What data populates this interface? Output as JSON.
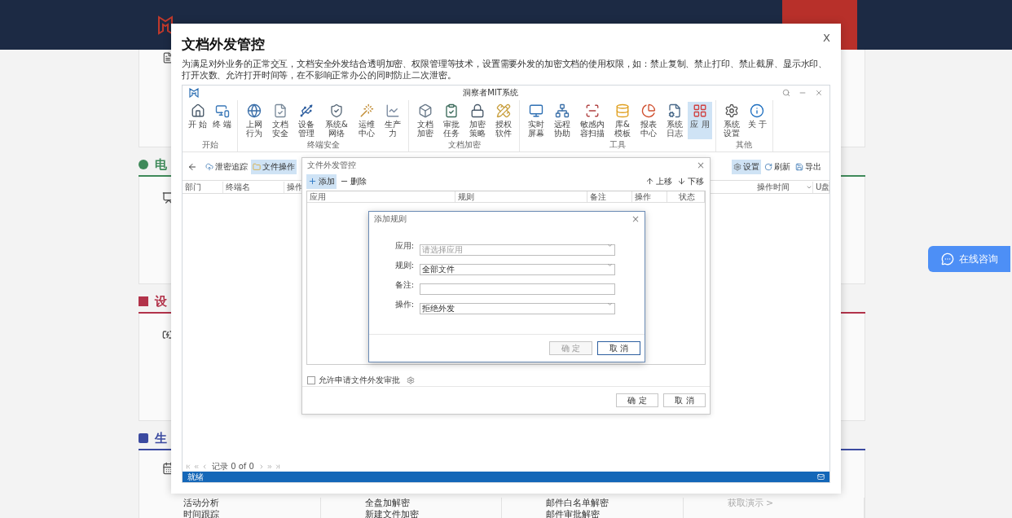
{
  "page": {
    "sections": [
      {
        "heading": "电",
        "color": "#3f8a5a"
      },
      {
        "heading": "设",
        "color": "#b2334a"
      },
      {
        "heading": "生",
        "color": "#3b4aa0"
      }
    ],
    "link_columns": [
      {
        "items": [
          "活动分析",
          "时间跟踪"
        ]
      },
      {
        "items": [
          "全盘加解密",
          "新建文件加密"
        ]
      },
      {
        "items": [
          "邮件白名单解密",
          "邮件审批解密"
        ]
      },
      {
        "items": [
          "获取演示 >"
        ],
        "muted": true
      }
    ],
    "consult_button": "在线咨询"
  },
  "modal": {
    "title": "文档外发管控",
    "close": "X",
    "description": "为满足对外业务的正常交互，文档安全外发结合透明加密、权限管理等技术，设置需要外发的加密文档的使用权限，如：禁止复制、禁止打印、禁止截屏、显示水印、打开次数、允许打开时间等，在不影响正常办公的同时防止二次泄密。"
  },
  "app": {
    "title": "洞察者MIT系统",
    "ribbon": [
      {
        "group": "开始",
        "items": [
          {
            "label": "开 始",
            "selected": false
          },
          {
            "label": "终 端",
            "selected": false
          }
        ]
      },
      {
        "group": "终端安全",
        "items": [
          {
            "label": "上网行为",
            "selected": false
          },
          {
            "label": "文档安全",
            "selected": false
          },
          {
            "label": "设备管理",
            "selected": false
          },
          {
            "label": "系统&网络",
            "selected": false
          },
          {
            "label": "运维中心",
            "selected": false
          },
          {
            "label": "生产力",
            "selected": false
          }
        ]
      },
      {
        "group": "文档加密",
        "items": [
          {
            "label": "文档加密",
            "selected": false
          },
          {
            "label": "审批任务",
            "selected": false
          },
          {
            "label": "加密策略",
            "selected": false
          },
          {
            "label": "授权软件",
            "selected": false
          }
        ]
      },
      {
        "group": "工具",
        "items": [
          {
            "label": "实时屏幕",
            "selected": false
          },
          {
            "label": "远程协助",
            "selected": false
          },
          {
            "label": "敏感内容扫描",
            "selected": false
          },
          {
            "label": "库&模板",
            "selected": false
          },
          {
            "label": "报表中心",
            "selected": false
          },
          {
            "label": "系统日志",
            "selected": false
          },
          {
            "label": "应 用",
            "selected": true
          }
        ]
      },
      {
        "group": "其他",
        "items": [
          {
            "label": "系统设置",
            "selected": false
          },
          {
            "label": "关 于",
            "selected": false
          }
        ]
      }
    ],
    "toolbar_left": [
      {
        "label": "泄密追踪",
        "selected": false
      },
      {
        "label": "文件操作",
        "selected": true
      }
    ],
    "toolbar_right": [
      {
        "label": "设置",
        "selected": true
      },
      {
        "label": "刷新",
        "selected": false
      },
      {
        "label": "导出",
        "selected": false
      }
    ],
    "columns_left": [
      "部门",
      "终端名",
      "操作"
    ],
    "columns_right": [
      "操作时间",
      "U盘"
    ],
    "pager": "记录 0 of 0",
    "status": "就绪"
  },
  "dialog": {
    "title": "文件外发管控",
    "close": "×",
    "toolbar_left": [
      {
        "label": "添加",
        "selected": true
      },
      {
        "label": "删除",
        "selected": false
      }
    ],
    "toolbar_right": [
      {
        "label": "上移"
      },
      {
        "label": "下移"
      }
    ],
    "columns": [
      "应用",
      "规则",
      "备注",
      "操作",
      "状态"
    ],
    "allow": {
      "label": "允许申请文件外发审批",
      "checked": false
    },
    "buttons": [
      {
        "label": "确 定"
      },
      {
        "label": "取 消"
      }
    ]
  },
  "rule_dialog": {
    "title": "添加规则",
    "close": "×",
    "fields": [
      {
        "label": "应用:",
        "kind": "select",
        "placeholder": "请选择应用"
      },
      {
        "label": "规则:",
        "kind": "select",
        "value": "全部文件"
      },
      {
        "label": "备注:",
        "kind": "text"
      },
      {
        "label": "操作:",
        "kind": "select",
        "value": "拒绝外发"
      }
    ],
    "buttons": [
      {
        "label": "确 定",
        "disabled": true,
        "focused": false
      },
      {
        "label": "取 消",
        "disabled": false,
        "focused": true
      }
    ]
  }
}
